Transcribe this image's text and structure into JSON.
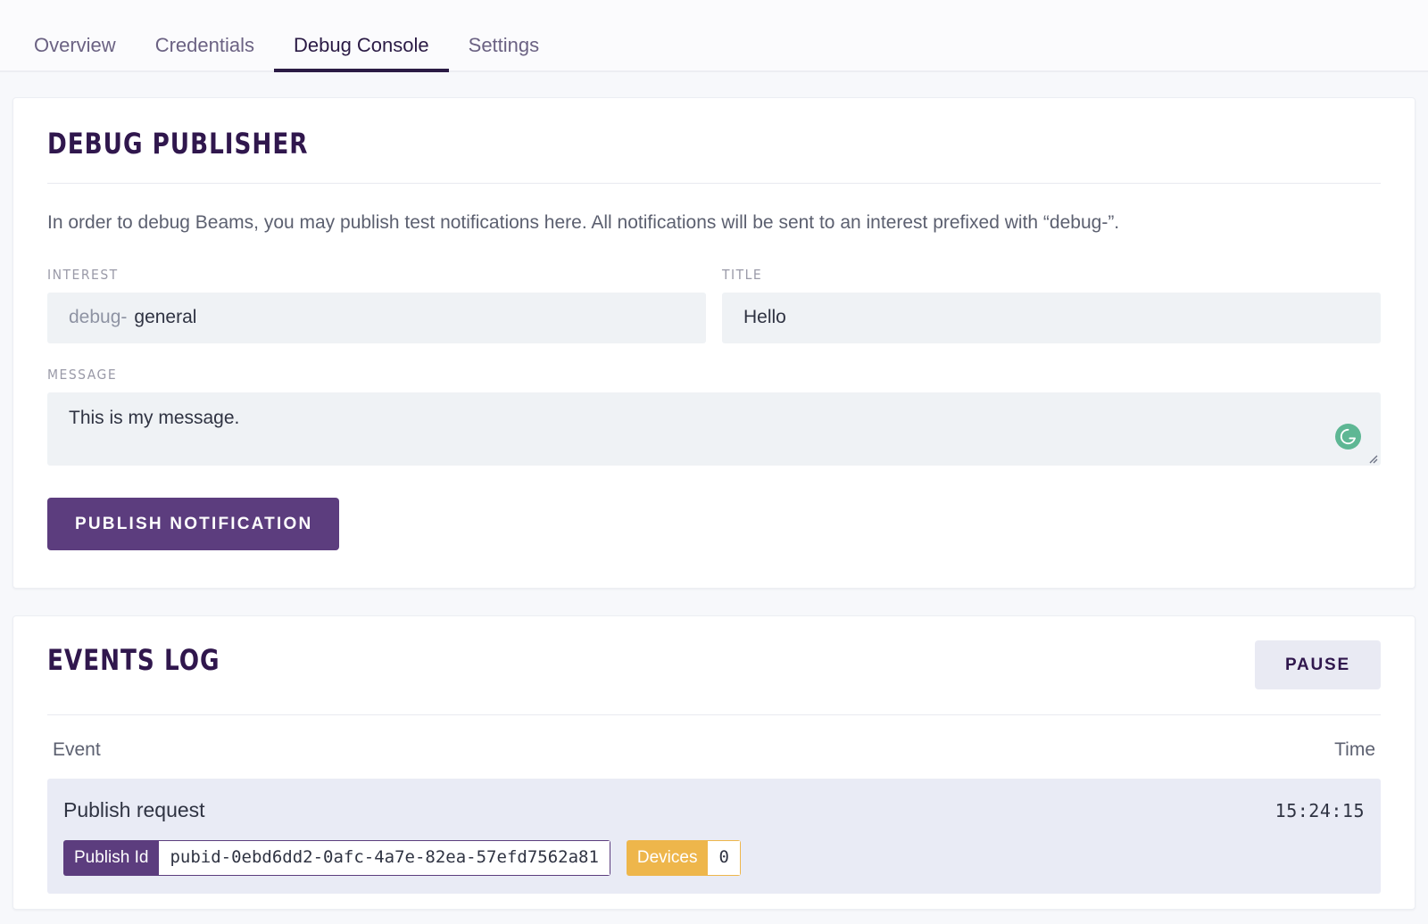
{
  "tabs": [
    {
      "label": "Overview",
      "active": false
    },
    {
      "label": "Credentials",
      "active": false
    },
    {
      "label": "Debug Console",
      "active": true
    },
    {
      "label": "Settings",
      "active": false
    }
  ],
  "publisher": {
    "title": "DEBUG PUBLISHER",
    "description": "In order to debug Beams, you may publish test notifications here. All notifications will be sent to an interest prefixed with “debug-”.",
    "interest": {
      "label": "INTEREST",
      "prefix": "debug-",
      "value": "general",
      "placeholder": "general"
    },
    "title_field": {
      "label": "TITLE",
      "value": "Hello",
      "placeholder": "Hello"
    },
    "message": {
      "label": "MESSAGE",
      "value": "This is my message.",
      "placeholder": "This is my message."
    },
    "publish_button": "PUBLISH NOTIFICATION",
    "grammarly_icon": "grammarly-g-icon",
    "resize_icon": "resize-handle-icon"
  },
  "events_log": {
    "title": "EVENTS LOG",
    "pause_button": "PAUSE",
    "columns": {
      "event": "Event",
      "time": "Time"
    },
    "rows": [
      {
        "event": "Publish request",
        "time": "15:24:15",
        "badges": [
          {
            "key": "Publish Id",
            "value": "pubid-0ebd6dd2-0afc-4a7e-82ea-57efd7562a81",
            "color": "#5c3d7e"
          },
          {
            "key": "Devices",
            "value": "0",
            "color": "#eeb64b"
          }
        ]
      }
    ]
  },
  "colors": {
    "accent_purple": "#5c3d7e",
    "title_purple": "#30174d",
    "amber": "#eeb64b",
    "grammarly_green": "#5eb794",
    "row_bg": "#e9ebf5",
    "input_bg": "#eff2f5",
    "page_bg": "#f7f8fb"
  }
}
